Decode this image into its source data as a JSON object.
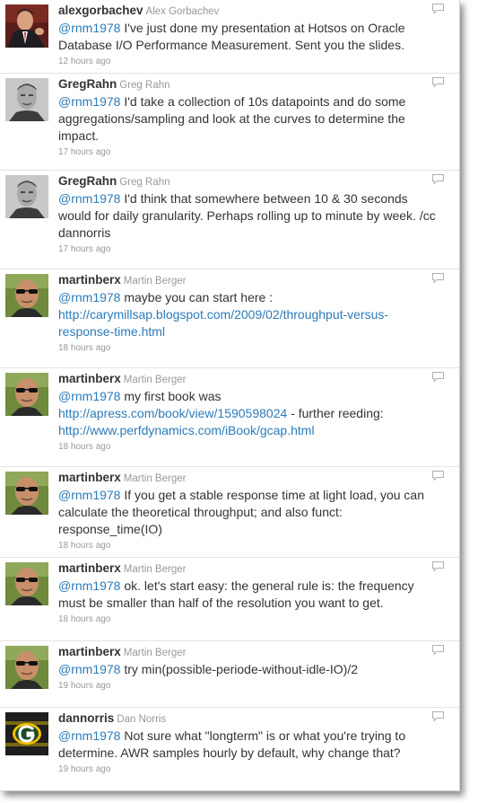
{
  "tweets": [
    {
      "screen_name": "alexgorbachev",
      "real_name": "Alex Gorbachev",
      "mention": "@rnm1978",
      "text": " I've just done my presentation at Hotsos on Oracle Database I/O Performance Measurement. Sent you the slides.",
      "time": "12 hours ago",
      "avatar": "suit-man-avatar"
    },
    {
      "screen_name": "GregRahn",
      "real_name": "Greg Rahn",
      "mention": "@rnm1978",
      "text": " I'd take a collection of 10s datapoints and do some aggregations/sampling and look at the curves to determine the impact.",
      "time": "17 hours ago",
      "avatar": "greg-avatar"
    },
    {
      "screen_name": "GregRahn",
      "real_name": "Greg Rahn",
      "mention": "@rnm1978",
      "text": " I'd think that somewhere between 10 & 30 seconds would for daily granularity. Perhaps rolling up to minute by week. /cc dannorris",
      "time": "17 hours ago",
      "avatar": "greg-avatar"
    },
    {
      "screen_name": "martinberx",
      "real_name": "Martin Berger",
      "mention": "@rnm1978",
      "text": " maybe you can start here : ",
      "link1": "http://carymillsap.blogspot.com/2009/02/throughput-versus-response-time.html",
      "time": "18 hours ago",
      "avatar": "sunglasses-avatar"
    },
    {
      "screen_name": "martinberx",
      "real_name": "Martin Berger",
      "mention": "@rnm1978",
      "text": " my first book was ",
      "link1": "http://apress.com/book/view/1590598024",
      "text2": " - further reeding: ",
      "link2": "http://www.perfdynamics.com/iBook/gcap.html",
      "time": "18 hours ago",
      "avatar": "sunglasses-avatar"
    },
    {
      "screen_name": "martinberx",
      "real_name": "Martin Berger",
      "mention": "@rnm1978",
      "text": " If you get a stable response time at light load, you can calculate the theoretical throughput; and also funct: response_time(IO)",
      "time": "18 hours ago",
      "avatar": "sunglasses-avatar"
    },
    {
      "screen_name": "martinberx",
      "real_name": "Martin Berger",
      "mention": "@rnm1978",
      "text": " ok. let's start easy: the general rule is: the frequency must be smaller than half of the resolution you want to get.",
      "time": "18 hours ago",
      "avatar": "sunglasses-avatar"
    },
    {
      "screen_name": "martinberx",
      "real_name": "Martin Berger",
      "mention": "@rnm1978",
      "text": " try min(possible-periode-without-idle-IO)/2",
      "time": "19 hours ago",
      "avatar": "sunglasses-avatar"
    },
    {
      "screen_name": "dannorris",
      "real_name": "Dan Norris",
      "mention": "@rnm1978",
      "text": " Not sure what \"longterm\" is or what you're trying to determine. AWR samples hourly by default, why change that?",
      "time": "19 hours ago",
      "avatar": "packers-logo-avatar"
    }
  ]
}
